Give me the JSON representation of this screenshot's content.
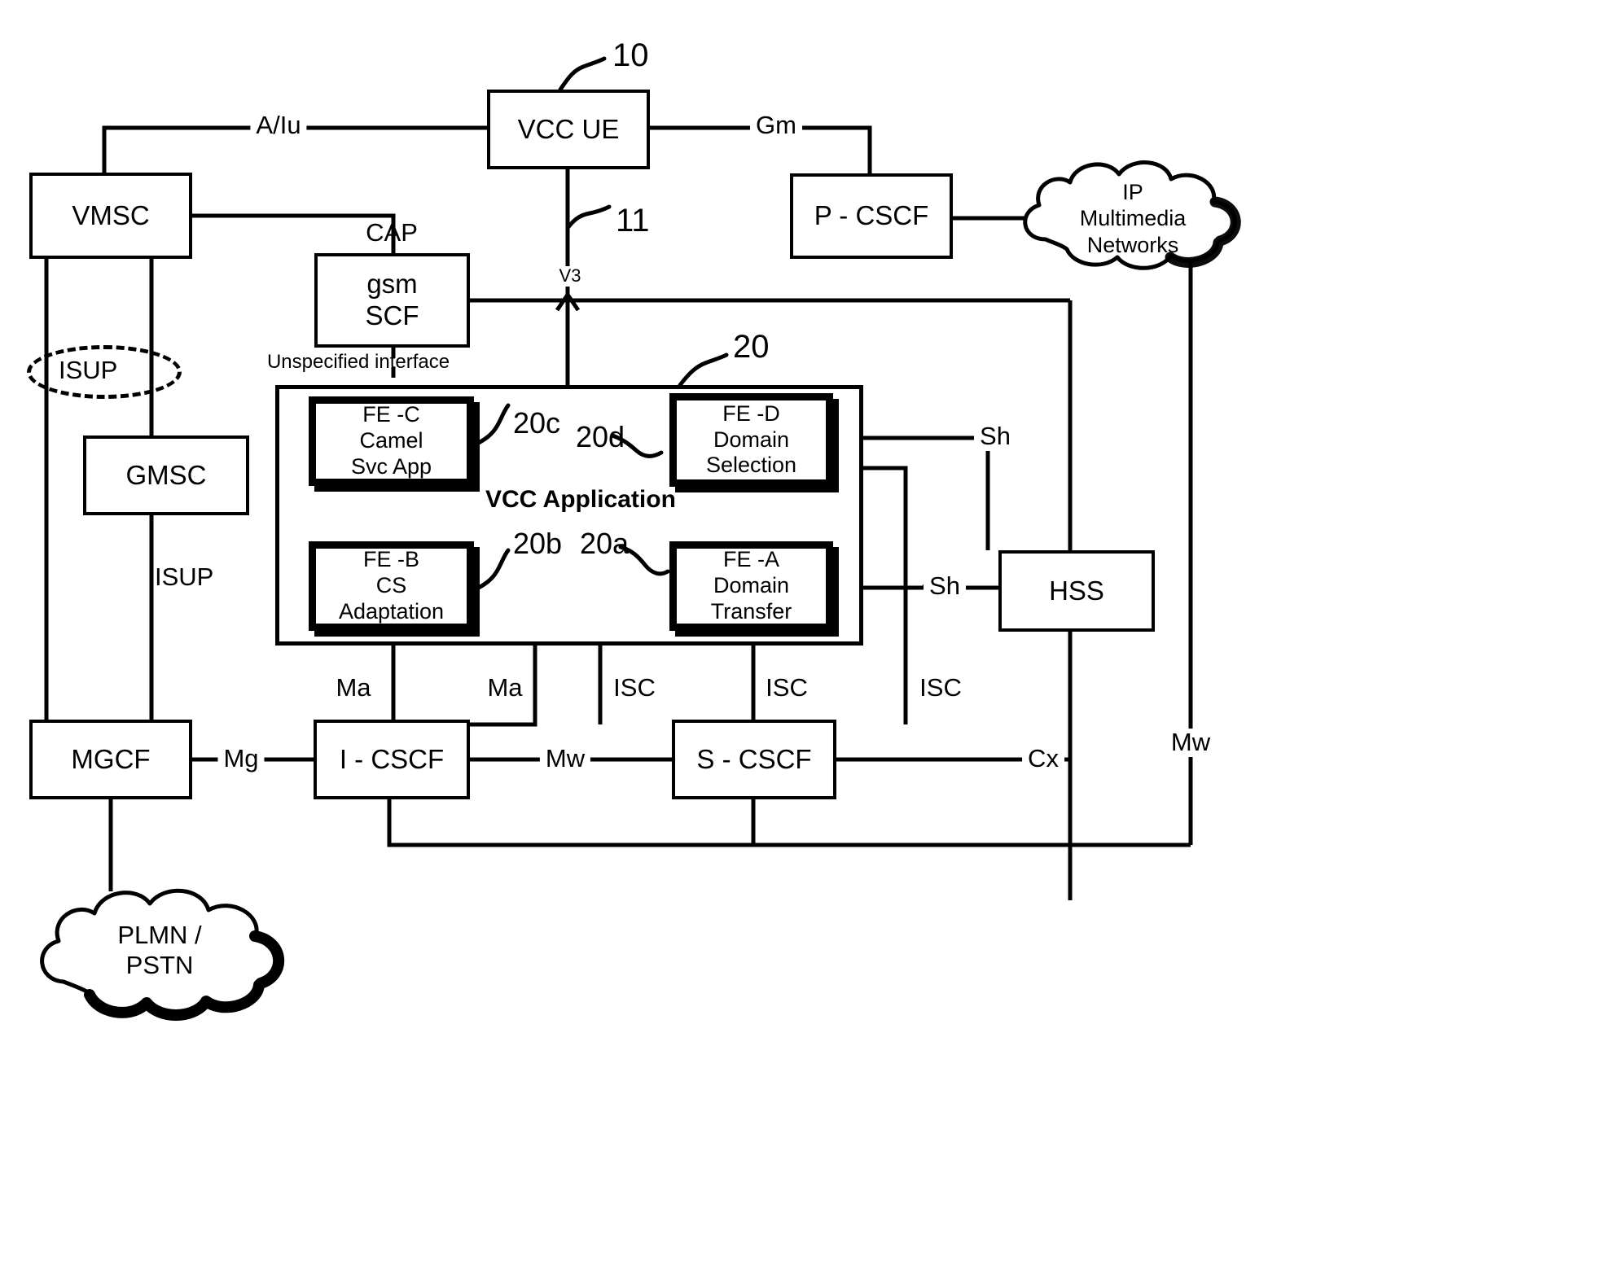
{
  "figure": {
    "title": "VCC network architecture reference diagram",
    "ref_numerals": {
      "ue": "10",
      "v3": "11",
      "vcc_app": "20",
      "fe_a": "20a",
      "fe_b": "20b",
      "fe_c": "20c",
      "fe_d": "20d"
    }
  },
  "nodes": {
    "vcc_ue": "VCC UE",
    "vmsc": "VMSC",
    "gmsc": "GMSC",
    "mgcf": "MGCF",
    "gsm_scf": "gsm\nSCF",
    "p_cscf": "P - CSCF",
    "i_cscf": "I - CSCF",
    "s_cscf": "S - CSCF",
    "hss": "HSS",
    "fe_c": "FE -C\nCamel\nSvc App",
    "fe_d": "FE -D\nDomain\nSelection",
    "fe_b": "FE -B\nCS\nAdaptation",
    "fe_a": "FE -A\nDomain\nTransfer",
    "vcc_application": "VCC Application"
  },
  "clouds": {
    "ip_multimedia": "IP\nMultimedia\nNetworks",
    "plmn_pstn": "PLMN  /\nPSTN"
  },
  "ellipse_label": "ISUP",
  "interfaces": {
    "a_iu": "A/Iu",
    "gm": "Gm",
    "cap": "CAP",
    "v3": "V3",
    "unspecified": "Unspecified interface",
    "isup_gmsc": "ISUP",
    "ma_left": "Ma",
    "ma_right": "Ma",
    "isc_1": "ISC",
    "isc_2": "ISC",
    "isc_3": "ISC",
    "mg": "Mg",
    "mw_mid": "Mw",
    "mw_right": "Mw",
    "cx": "Cx",
    "sh_top": "Sh",
    "sh_bottom": "Sh"
  },
  "colors": {
    "line": "#000000",
    "background": "#ffffff"
  }
}
